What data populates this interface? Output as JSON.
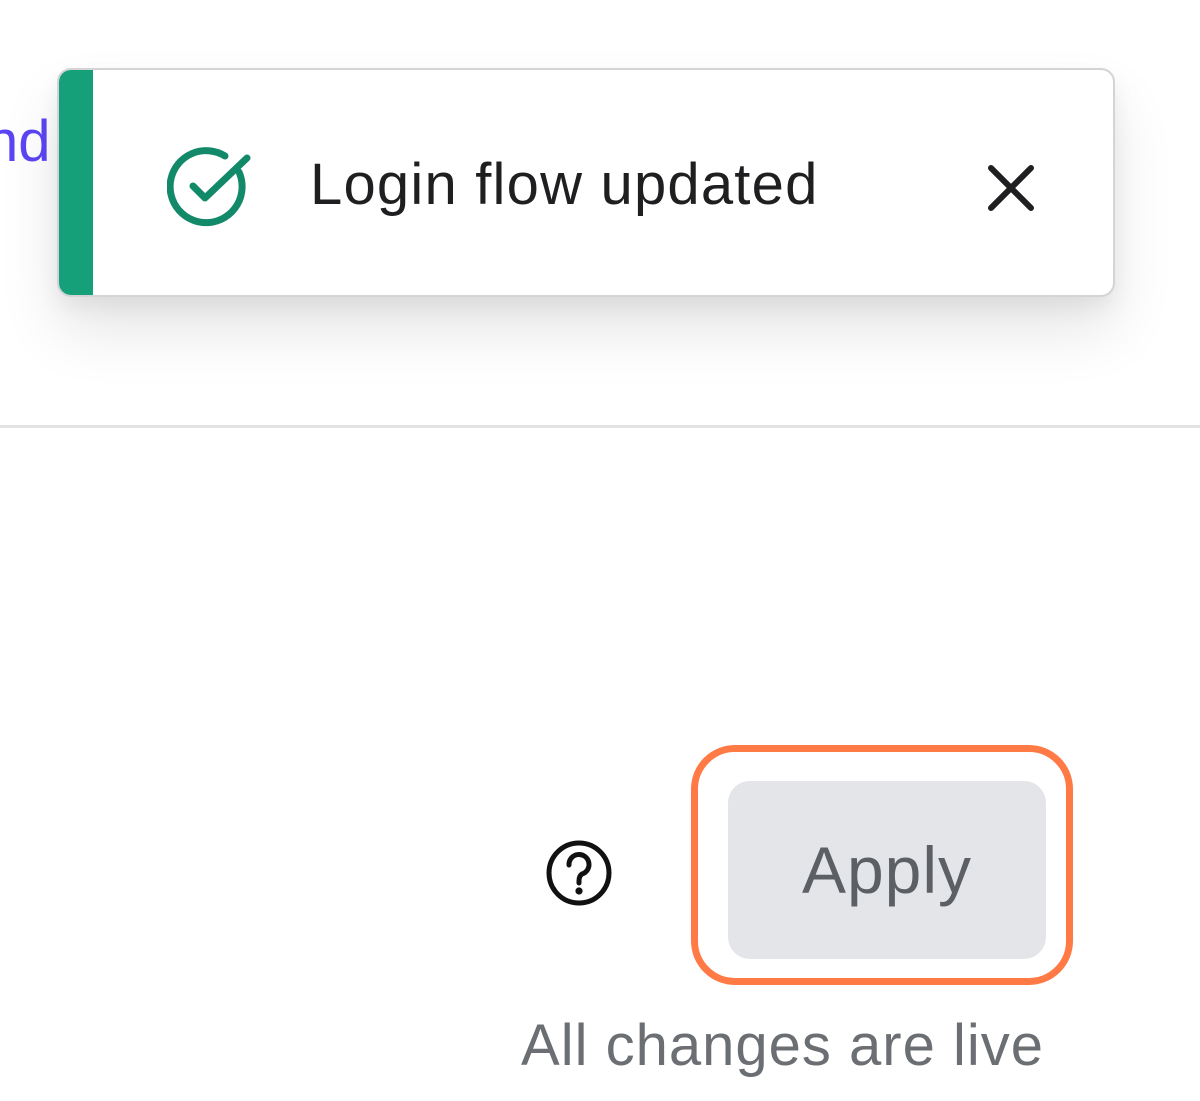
{
  "background": {
    "link_fragment": "nd",
    "link_color": "#5b45f5"
  },
  "toast": {
    "message": "Login flow updated",
    "icon": "check-circle-icon",
    "close_icon": "close-icon",
    "accent_color": "#16a07a"
  },
  "actions": {
    "help_icon": "help-circle-icon",
    "apply_label": "Apply",
    "focus_ring_color": "#ff7a45",
    "status": "All changes are live"
  }
}
